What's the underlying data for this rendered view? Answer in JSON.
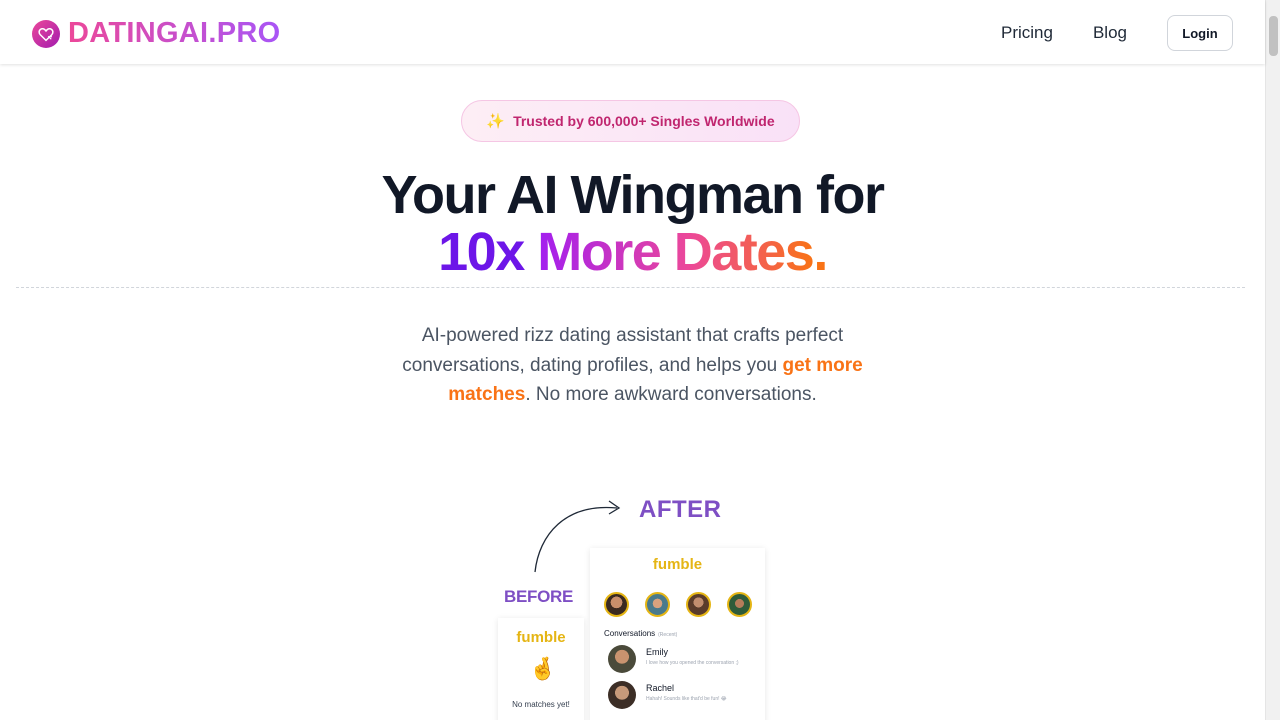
{
  "header": {
    "logo_text": "DATINGAI.PRO",
    "nav": {
      "pricing": "Pricing",
      "blog": "Blog",
      "login": "Login"
    }
  },
  "hero": {
    "badge_icon": "✨",
    "badge_text": "Trusted by 600,000+ Singles Worldwide",
    "title_line1": "Your AI Wingman for",
    "title_line2_a": "10x",
    "title_line2_b": "More Dates",
    "title_line2_dot": ".",
    "subtitle_pre": "AI-powered rizz dating assistant that crafts perfect conversations, dating profiles, and helps you",
    "subtitle_highlight": "get more matches",
    "subtitle_post": ". No more awkward conversations."
  },
  "comparison": {
    "after_label": "AFTER",
    "before_label": "BEFORE",
    "after_card": {
      "brand": "fumble",
      "conversations_label": "Conversations",
      "conversations_sub": "(Recent)",
      "conversations": [
        {
          "name": "Emily",
          "message": "I love how you opened the conversation ;)"
        },
        {
          "name": "Rachel",
          "message": "Hahah! Sounds like that'd be fun! 😂"
        }
      ]
    },
    "before_card": {
      "brand": "fumble",
      "icon": "🤞",
      "empty_text": "No matches yet!"
    }
  },
  "colors": {
    "brand_pink": "#ec4899",
    "brand_purple": "#a855f7",
    "accent_orange": "#f97316",
    "label_purple": "#7e4fc4",
    "fumble_yellow": "#e5b514"
  }
}
